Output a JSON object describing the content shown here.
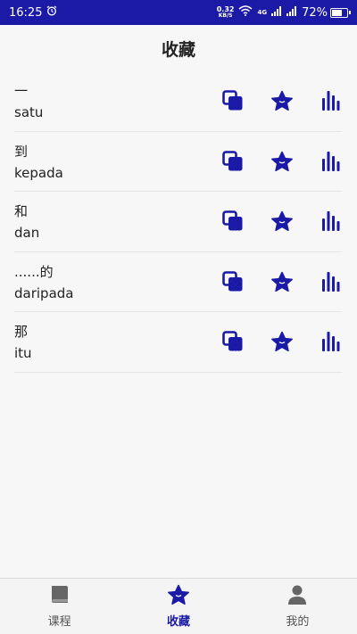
{
  "status_bar": {
    "time": "16:25",
    "net_speed": "0.32",
    "net_unit": "KB/S",
    "network_type": "4G",
    "battery_percent": "72%",
    "battery_level": 0.72,
    "bg_color": "#1a1aa6"
  },
  "header": {
    "title": "收藏"
  },
  "favorites": [
    {
      "native": "一",
      "foreign": "satu"
    },
    {
      "native": "到",
      "foreign": "kepada"
    },
    {
      "native": "和",
      "foreign": "dan"
    },
    {
      "native": "......的",
      "foreign": "daripada"
    },
    {
      "native": "那",
      "foreign": "itu"
    }
  ],
  "row_icons": [
    "copy-icon",
    "star-icon",
    "bar-chart-icon"
  ],
  "accent_color": "#1a1aa6",
  "bottom_nav": {
    "items": [
      {
        "label": "课程",
        "icon": "book-icon",
        "active": false
      },
      {
        "label": "收藏",
        "icon": "star-icon",
        "active": true
      },
      {
        "label": "我的",
        "icon": "person-icon",
        "active": false
      }
    ]
  }
}
